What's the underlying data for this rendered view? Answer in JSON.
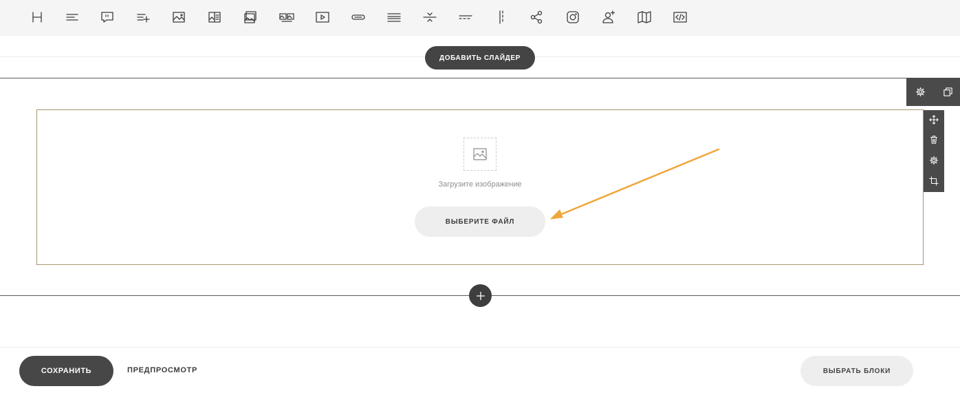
{
  "toolbar": {
    "icons": [
      "heading-icon",
      "text-icon",
      "quote-icon",
      "list-add-icon",
      "image-icon",
      "image-text-icon",
      "gallery-icon",
      "slider-icon",
      "video-icon",
      "button-icon",
      "lines-icon",
      "divider-icon",
      "dashed-line-icon",
      "vertical-line-icon",
      "share-icon",
      "instagram-icon",
      "user-add-icon",
      "map-icon",
      "code-icon"
    ]
  },
  "slider": {
    "add_label": "ДОБАВИТЬ СЛАЙДЕР"
  },
  "row_tools": {
    "icons": [
      "gear-icon",
      "copy-icon"
    ]
  },
  "block_tools": {
    "icons": [
      "move-icon",
      "trash-icon",
      "gear-icon",
      "crop-icon"
    ]
  },
  "image_block": {
    "upload_text": "Загрузите изображение",
    "choose_label": "ВЫБЕРИТЕ ФАЙЛ"
  },
  "footer": {
    "save_label": "СОХРАНИТЬ",
    "preview_label": "ПРЕДПРОСМОТР",
    "blocks_label": "ВЫБРАТЬ БЛОКИ"
  },
  "colors": {
    "dark": "#444444",
    "light_button": "#eeeeee",
    "block_border": "#a49770",
    "annotation_arrow": "#f0a63a"
  }
}
